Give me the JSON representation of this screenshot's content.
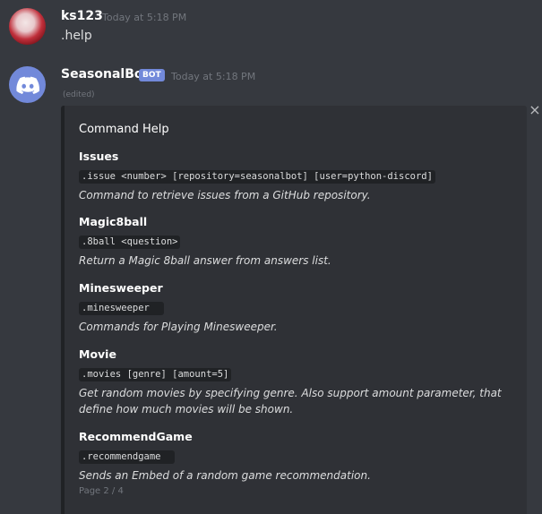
{
  "messages": {
    "user": {
      "name": "ks123",
      "timestamp": "Today at 5:18 PM",
      "text": ".help"
    },
    "bot": {
      "name": "SeasonalBot",
      "badge": "BOT",
      "timestamp": "Today at 5:18 PM",
      "edited": "(edited)"
    }
  },
  "embed": {
    "title": "Command Help",
    "close_glyph": "×",
    "fields": [
      {
        "name": "Issues",
        "usage": ".issue <number> [repository=seasonalbot] [user=python-discord]",
        "description": "Command to retrieve issues from a GitHub repository."
      },
      {
        "name": "Magic8ball",
        "usage": ".8ball <question>",
        "description": "Return a Magic 8ball answer from answers list."
      },
      {
        "name": "Minesweeper",
        "usage": ".minesweeper  ",
        "description": "Commands for Playing Minesweeper."
      },
      {
        "name": "Movie",
        "usage": ".movies [genre] [amount=5]",
        "description": "Get random movies by specifying genre. Also support amount parameter, that define how much movies will be shown."
      },
      {
        "name": "RecommendGame",
        "usage": ".recommendgame  ",
        "description": "Sends an Embed of a random game recommendation."
      }
    ],
    "footer": "Page 2 / 4"
  },
  "colors": {
    "background": "#36393f",
    "embed_background": "#2f3136",
    "blurple": "#7289da",
    "timestamp": "#72767d"
  },
  "icons": {
    "bot_avatar": "discord-logo-icon",
    "close": "close-icon"
  }
}
